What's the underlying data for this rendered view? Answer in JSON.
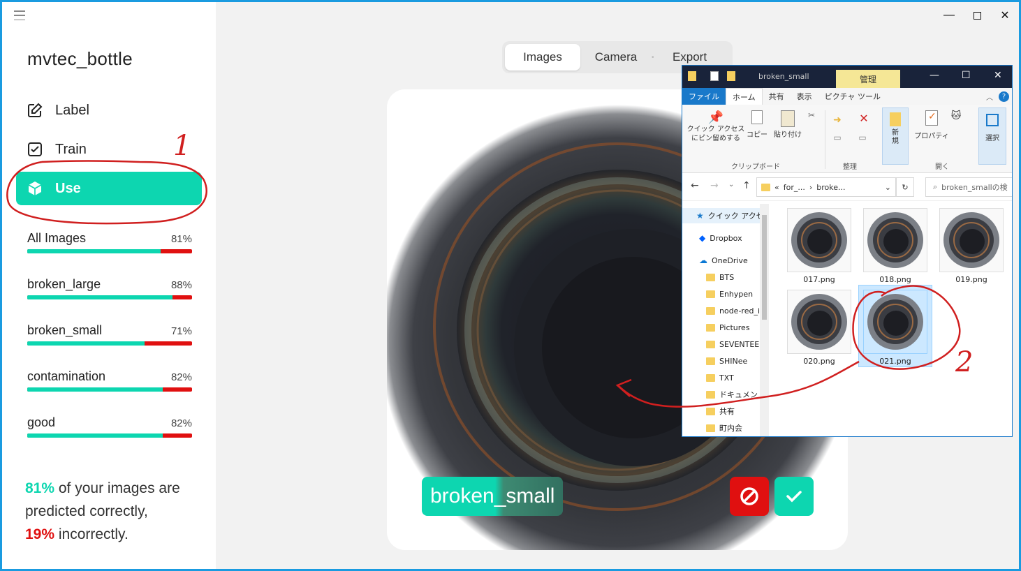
{
  "app": {
    "project_title": "mvtec_bottle",
    "nav": [
      {
        "label": "Label",
        "icon": "edit-icon"
      },
      {
        "label": "Train",
        "icon": "checkbox-icon"
      },
      {
        "label": "Use",
        "icon": "cube-icon"
      }
    ],
    "stats": [
      {
        "name": "All Images",
        "pct": "81%",
        "fraction": 0.81
      },
      {
        "name": "broken_large",
        "pct": "88%",
        "fraction": 0.88
      },
      {
        "name": "broken_small",
        "pct": "71%",
        "fraction": 0.71
      },
      {
        "name": "contamination",
        "pct": "82%",
        "fraction": 0.82
      },
      {
        "name": "good",
        "pct": "82%",
        "fraction": 0.82
      }
    ],
    "summary": {
      "good_pct": "81%",
      "line1": " of your images are",
      "line2": "predicted correctly,",
      "bad_pct": "19%",
      "line3": " incorrectly."
    },
    "tabs": [
      "Images",
      "Camera",
      "Export"
    ],
    "active_tab": "Images",
    "prediction_label": "broken_small",
    "colors": {
      "accent": "#0dd6b0",
      "error": "#e01010"
    }
  },
  "explorer": {
    "window_title": "broken_small",
    "context_tab": "管理",
    "menu": [
      "ファイル",
      "ホーム",
      "共有",
      "表示",
      "ピクチャ ツール"
    ],
    "ribbon": {
      "pin": "クイック アクセス\nにピン留めする",
      "copy": "コピー",
      "paste": "貼り付け",
      "group_clipboard": "クリップボード",
      "group_organize": "整理",
      "new": "新\n規",
      "properties": "プロパティ",
      "group_open": "開く",
      "select": "選択"
    },
    "address": {
      "part1": "for_...",
      "part2": "broke...",
      "prefix": "«"
    },
    "search_placeholder": "broken_smallの検",
    "nav_items": [
      {
        "label": "クイック アクセス",
        "kind": "star"
      },
      {
        "label": "Dropbox",
        "kind": "dropbox"
      },
      {
        "label": "OneDrive",
        "kind": "cloud"
      },
      {
        "label": "BTS",
        "kind": "folder"
      },
      {
        "label": "Enhypen",
        "kind": "folder"
      },
      {
        "label": "node-red_i",
        "kind": "folder"
      },
      {
        "label": "Pictures",
        "kind": "folder"
      },
      {
        "label": "SEVENTEEN",
        "kind": "folder"
      },
      {
        "label": "SHINee",
        "kind": "folder"
      },
      {
        "label": "TXT",
        "kind": "folder"
      },
      {
        "label": "ドキュメント",
        "kind": "folder"
      },
      {
        "label": "共有",
        "kind": "folder"
      },
      {
        "label": "町内会",
        "kind": "folder"
      }
    ],
    "files": [
      "017.png",
      "018.png",
      "019.png",
      "020.png",
      "021.png"
    ],
    "selected_file": "021.png"
  },
  "annotations": {
    "marker_1": "1",
    "marker_2": "2"
  }
}
